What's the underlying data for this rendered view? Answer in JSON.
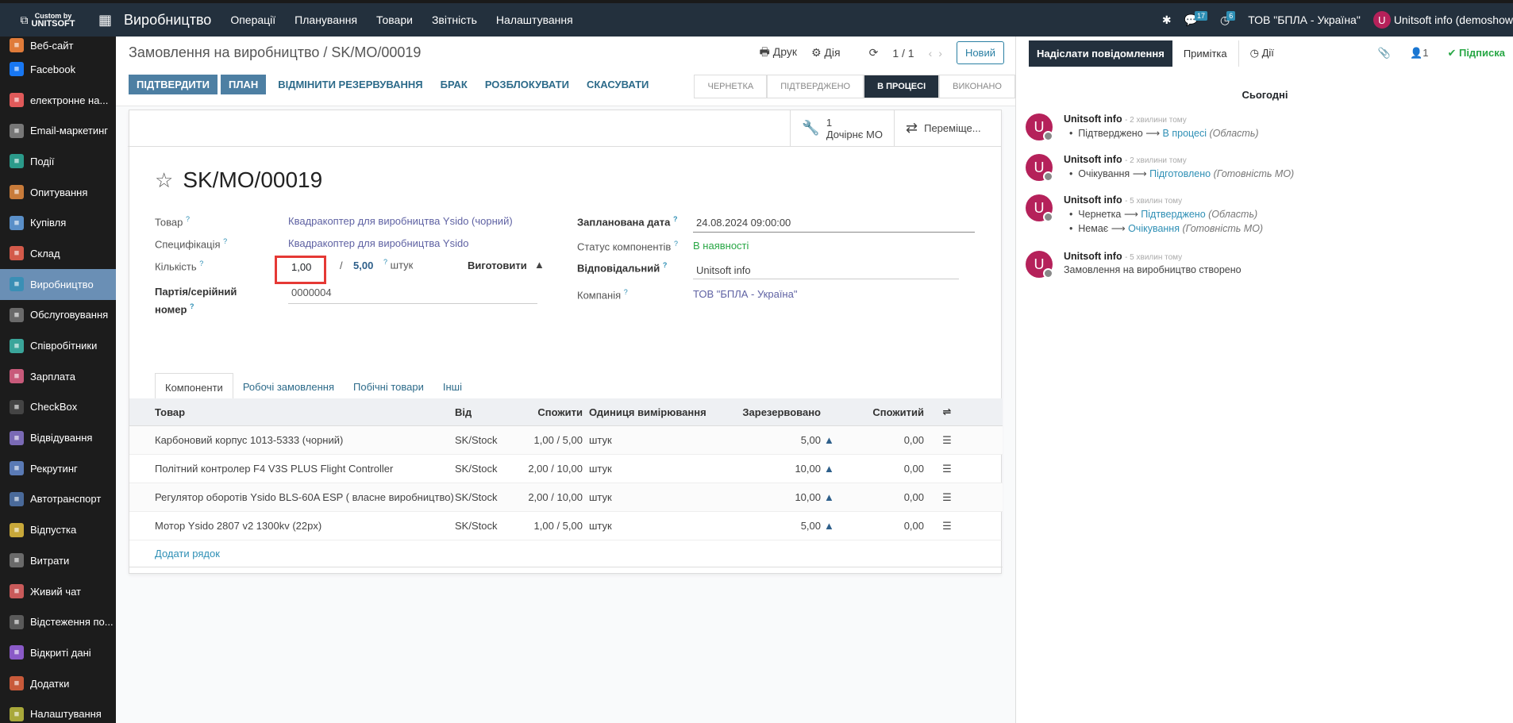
{
  "topbar": {
    "logo_line1": "Custom by",
    "logo_line2": "UNITSOFT",
    "app_title": "Виробництво",
    "menu": [
      "Операції",
      "Планування",
      "Товари",
      "Звітність",
      "Налаштування"
    ],
    "messages_count": "17",
    "activities_count": "6",
    "company": "ТОВ \"БПЛА - Україна\"",
    "user": "Unitsoft info (demoshow",
    "user_initial": "U"
  },
  "sidebar": {
    "items": [
      {
        "label": "Веб-сайт",
        "color": "#e07b39"
      },
      {
        "label": "Facebook",
        "color": "#1877f2"
      },
      {
        "label": "електронне на...",
        "color": "#e05a5a"
      },
      {
        "label": "Email-маркетинг",
        "color": "#777777"
      },
      {
        "label": "Події",
        "color": "#2b9a8a"
      },
      {
        "label": "Опитування",
        "color": "#c87b3a"
      },
      {
        "label": "Купівля",
        "color": "#5a8fc8"
      },
      {
        "label": "Склад",
        "color": "#d35a4a"
      },
      {
        "label": "Виробництво",
        "color": "#3a8fb5",
        "active": true
      },
      {
        "label": "Обслуговування",
        "color": "#6a6a6a"
      },
      {
        "label": "Співробітники",
        "color": "#3aa59a"
      },
      {
        "label": "Зарплата",
        "color": "#c85a7a"
      },
      {
        "label": "CheckBox",
        "color": "#444444"
      },
      {
        "label": "Відвідування",
        "color": "#7a6ab5"
      },
      {
        "label": "Рекрутинг",
        "color": "#5a7ab5"
      },
      {
        "label": "Автотранспорт",
        "color": "#4a6a9a"
      },
      {
        "label": "Відпустка",
        "color": "#c8a83a"
      },
      {
        "label": "Витрати",
        "color": "#6a6a6a"
      },
      {
        "label": "Живий чат",
        "color": "#c85a5a"
      },
      {
        "label": "Відстеження по...",
        "color": "#5a5a5a"
      },
      {
        "label": "Відкриті дані",
        "color": "#8a5ac8"
      },
      {
        "label": "Додатки",
        "color": "#c85a3a"
      },
      {
        "label": "Налаштування",
        "color": "#a8a83a"
      }
    ]
  },
  "control_panel": {
    "breadcrumb": "Замовлення на виробництво / SK/MO/00019",
    "print": "Друк",
    "action": "Дія",
    "pager": "1 / 1",
    "new_button": "Новий"
  },
  "actions": {
    "confirm": "ПІДТВЕРДИТИ",
    "plan": "ПЛАН",
    "unreserve": "ВІДМІНИТИ РЕЗЕРВУВАННЯ",
    "scrap": "БРАК",
    "unlock": "РОЗБЛОКУВАТИ",
    "cancel": "СКАСУВАТИ"
  },
  "status": [
    "ЧЕРНЕТКА",
    "ПІДТВЕРДЖЕНО",
    "В ПРОЦЕСІ",
    "ВИКОНАНО"
  ],
  "status_active": "В ПРОЦЕСІ",
  "smart_buttons": {
    "child_count": "1",
    "child_label": "Дочірнє МО",
    "moves_label": "Переміще..."
  },
  "form": {
    "title": "SK/MO/00019",
    "product_label": "Товар",
    "product_value": "Квадракоптер для виробництва Ysido (чорний)",
    "bom_label": "Специфікація",
    "bom_value": "Квадракоптер для виробництва Ysido",
    "qty_label": "Кількість",
    "qty_value": "1,00",
    "qty_total": "5,00",
    "qty_unit": "штук",
    "produce_label": "Виготовити",
    "lot_label_1": "Партія/серійний",
    "lot_label_2": "номер",
    "lot_value": "0000004",
    "date_label": "Запланована дата",
    "date_value": "24.08.2024 09:00:00",
    "comp_status_label": "Статус компонентів",
    "comp_status_value": "В наявності",
    "responsible_label": "Відповідальний",
    "responsible_value": "Unitsoft info",
    "company_label": "Компанія",
    "company_value": "ТОВ \"БПЛА - Україна\""
  },
  "tabs": [
    "Компоненти",
    "Робочі замовлення",
    "Побічні товари",
    "Інші"
  ],
  "table": {
    "headers": [
      "Товар",
      "Від",
      "Спожити",
      "Одиниця вимірювання",
      "Зарезервовано",
      "Спожитий"
    ],
    "rows": [
      {
        "product": "Карбоновий корпус 1013-5333 (чорний)",
        "from": "SK/Stock",
        "consume": "1,00 / 5,00",
        "uom": "штук",
        "reserved": "5,00",
        "consumed": "0,00"
      },
      {
        "product": "Політний контролер F4 V3S PLUS Flight Controller",
        "from": "SK/Stock",
        "consume": "2,00 / 10,00",
        "uom": "штук",
        "reserved": "10,00",
        "consumed": "0,00"
      },
      {
        "product": "Регулятор оборотів Ysido BLS-60A ESP ( власне виробництво)",
        "from": "SK/Stock",
        "consume": "2,00 / 10,00",
        "uom": "штук",
        "reserved": "10,00",
        "consumed": "0,00"
      },
      {
        "product": "Мотор Ysido 2807 v2 1300kv (22px)",
        "from": "SK/Stock",
        "consume": "1,00 / 5,00",
        "uom": "штук",
        "reserved": "5,00",
        "consumed": "0,00"
      }
    ],
    "add_line": "Додати рядок"
  },
  "chatter": {
    "send_message": "Надіслати повідомлення",
    "note": "Примітка",
    "activities": "Дії",
    "followers": "1",
    "follow": "Підписка",
    "today": "Сьогодні",
    "messages": [
      {
        "author": "Unitsoft info",
        "time": "- 2 хвилини тому",
        "lines": [
          {
            "old": "Підтверджено",
            "new": "В процесі",
            "field": "(Область)"
          }
        ]
      },
      {
        "author": "Unitsoft info",
        "time": "- 2 хвилини тому",
        "lines": [
          {
            "old": "Очікування",
            "new": "Підготовлено",
            "field": "(Готовність МО)"
          }
        ]
      },
      {
        "author": "Unitsoft info",
        "time": "- 5 хвилин тому",
        "lines": [
          {
            "old": "Чернетка",
            "new": "Підтверджено",
            "field": "(Область)"
          },
          {
            "old": "Немає",
            "new": "Очікування",
            "field": "(Готовність МО)"
          }
        ]
      },
      {
        "author": "Unitsoft info",
        "time": "- 5 хвилин тому",
        "text": "Замовлення на виробництво створено"
      }
    ]
  }
}
